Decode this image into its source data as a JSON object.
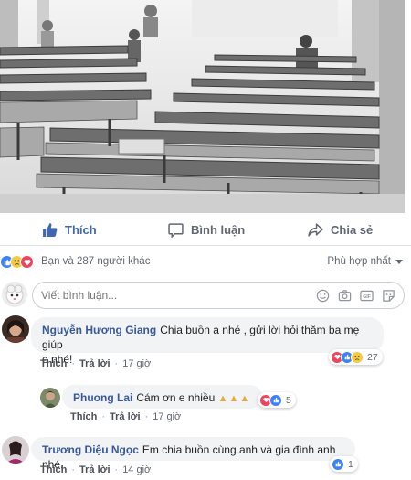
{
  "post": {
    "image_alt": "church interior with rows of wooden pews"
  },
  "actions": {
    "like": "Thích",
    "comment": "Bình luận",
    "share": "Chia sẻ"
  },
  "reactions": {
    "summary": "Bạn và 287 người khác",
    "sort": "Phù hợp nhất"
  },
  "composer": {
    "placeholder": "Viết bình luận...",
    "tools": [
      "emoji-icon",
      "camera-icon",
      "gif-icon",
      "sticker-icon"
    ]
  },
  "comments": [
    {
      "author": "Nguyễn Hương Giang",
      "text_line1": "Chia buồn a nhé , gửi lời hỏi thăm ba mẹ giúp",
      "text_line2": "e nhé!",
      "like": "Thích",
      "reply": "Trả lời",
      "time": "17 giờ",
      "reaction_count": "27"
    },
    {
      "author": "Phuong Lai",
      "text": "Cám ơn e nhiều",
      "emoji": "🙏🙏🙏",
      "like": "Thích",
      "reply": "Trả lời",
      "time": "17 giờ",
      "reaction_count": "5"
    },
    {
      "author": "Trương Diệu Ngọc",
      "text": "Em chia buồn cùng anh và gia đình anh nhé.",
      "like": "Thích",
      "reply": "Trả lời",
      "time": "14 giờ",
      "reaction_count": "1"
    }
  ],
  "colors": {
    "link_blue": "#385898",
    "like_blue": "#4267b2",
    "bubble_gray": "#f2f3f5",
    "meta_gray": "#606770"
  }
}
